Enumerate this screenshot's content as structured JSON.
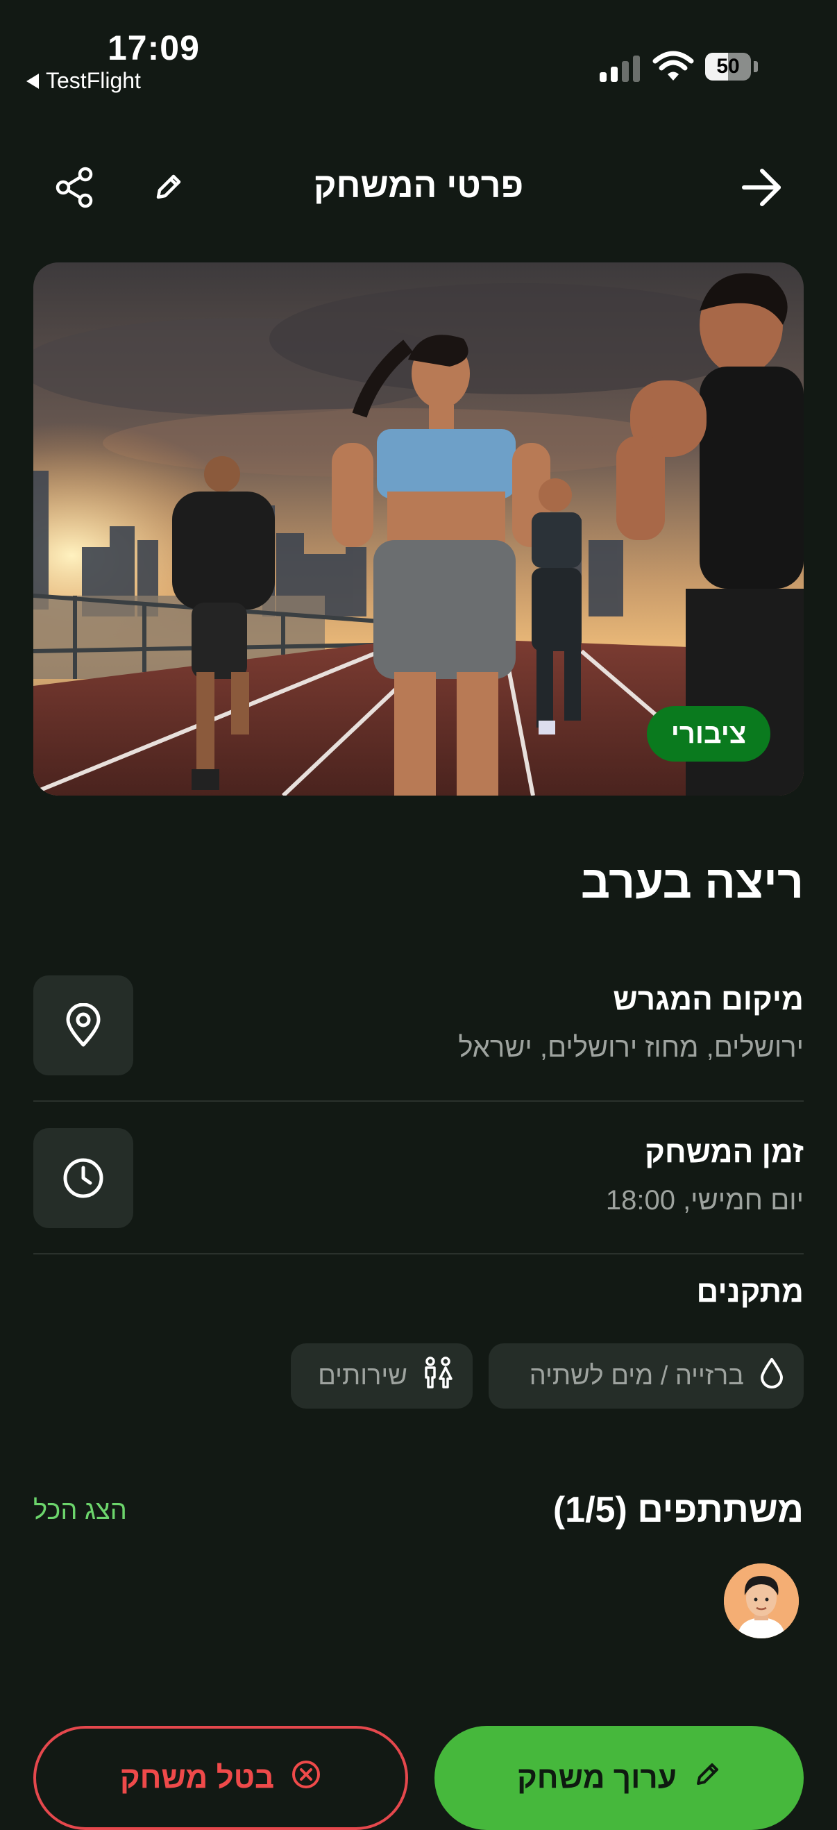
{
  "status_bar": {
    "time": "17:09",
    "back_app": "TestFlight",
    "battery": "50"
  },
  "header": {
    "title": "פרטי המשחק",
    "icons": [
      "share-icon",
      "pencil-icon",
      "arrow-right-icon"
    ]
  },
  "hero": {
    "badge": "ציבורי"
  },
  "game": {
    "title": "ריצה בערב"
  },
  "location": {
    "label": "מיקום המגרש",
    "value": "ירושלים, מחוז ירושלים, ישראל",
    "icon": "map-pin-icon"
  },
  "time": {
    "label": "זמן המשחק",
    "value": "יום חמישי, 18:00",
    "icon": "clock-icon"
  },
  "facilities": {
    "title": "מתקנים",
    "items": [
      {
        "label": "ברזייה / מים לשתיה",
        "icon": "water-drop-icon"
      },
      {
        "label": "שירותים",
        "icon": "restroom-icon"
      }
    ]
  },
  "participants": {
    "title": "משתתפים (1/5)",
    "show_all": "הצג הכל"
  },
  "actions": {
    "cancel": "בטל משחק",
    "edit": "ערוך משחק"
  },
  "colors": {
    "background": "#121914",
    "accent_green": "#46b83c",
    "danger_red": "#e5484d",
    "badge_green": "#0a7a1e"
  }
}
